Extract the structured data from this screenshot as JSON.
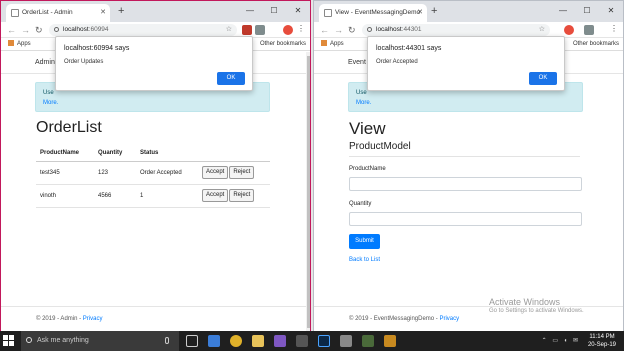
{
  "left_window": {
    "tab_title": "OrderList - Admin",
    "address_host": "localhost",
    "address_port": ":60994",
    "bookmarks": {
      "apps": "Apps",
      "other": "Other bookmarks"
    },
    "navbar_brand": "Admin",
    "alert_text": "Use",
    "alert_link": "More.",
    "heading": "OrderList",
    "table": {
      "headers": [
        "ProductName",
        "Quantity",
        "Status"
      ],
      "rows": [
        {
          "product": "test345",
          "quantity": "123",
          "status": "Order Accepted",
          "accept": "Accept",
          "reject": "Reject"
        },
        {
          "product": "vinoth",
          "quantity": "4566",
          "status": "1",
          "accept": "Accept",
          "reject": "Reject"
        }
      ]
    },
    "footer_text": "© 2019 - Admin - ",
    "footer_link": "Privacy",
    "dialog": {
      "title": "localhost:60994 says",
      "message": "Order Updates",
      "ok": "OK"
    }
  },
  "right_window": {
    "tab_title": "View - EventMessagingDemo",
    "address_host": "localhost",
    "address_port": ":44301",
    "bookmarks": {
      "apps": "Apps",
      "other": "Other bookmarks"
    },
    "navbar_brand": "Event",
    "alert_text": "Use",
    "alert_link": "More.",
    "heading": "View",
    "subheading": "ProductModel",
    "fields": [
      "ProductName",
      "Quantity"
    ],
    "submit": "Submit",
    "back_link": "Back to List",
    "footer_text": "© 2019 - EventMessagingDemo - ",
    "footer_link": "Privacy",
    "dialog": {
      "title": "localhost:44301 says",
      "message": "Order Accepted",
      "ok": "OK"
    }
  },
  "watermark": {
    "line1": "Activate Windows",
    "line2": "Go to Settings to activate Windows."
  },
  "taskbar": {
    "search_placeholder": "Ask me anything",
    "time": "11:14 PM",
    "date": "20-Sep-19"
  },
  "colors": {
    "primary": "#007bff",
    "dialog_ok": "#1a73e8",
    "alert_bg": "#d1ecf1",
    "taskbar": "#1f1f1f"
  }
}
